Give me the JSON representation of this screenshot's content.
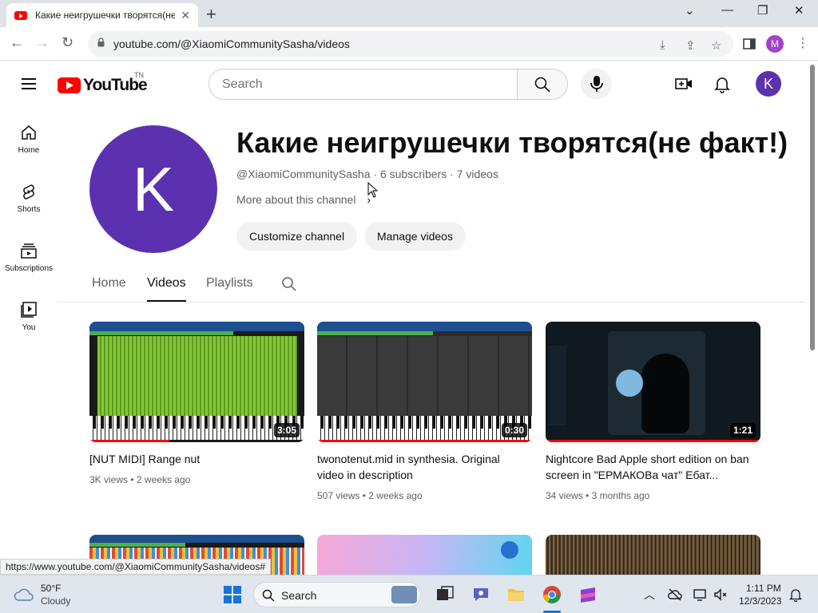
{
  "browser": {
    "tab_title": "Какие неигрушечки творятся(не факт!)",
    "url": "youtube.com/@XiaomiCommunitySasha/videos",
    "profile_initial": "M",
    "status_url": "https://www.youtube.com/@XiaomiCommunitySasha/videos#"
  },
  "header": {
    "logo_text": "YouTube",
    "logo_region": "TN",
    "search_placeholder": "Search",
    "avatar_initial": "K"
  },
  "sidebar": {
    "items": [
      {
        "label": "Home",
        "icon": "home-icon"
      },
      {
        "label": "Shorts",
        "icon": "shorts-icon"
      },
      {
        "label": "Subscriptions",
        "icon": "subscriptions-icon"
      },
      {
        "label": "You",
        "icon": "you-icon"
      }
    ]
  },
  "channel": {
    "avatar_initial": "K",
    "name": "Какие неигрушечки творятся(не факт!)",
    "handle": "@XiaomiCommunitySasha",
    "subscribers": "6 subscribers",
    "video_count": "7 videos",
    "more_about": "More about this channel",
    "customize_label": "Customize channel",
    "manage_label": "Manage videos"
  },
  "tabs": [
    {
      "label": "Home",
      "active": false
    },
    {
      "label": "Videos",
      "active": true
    },
    {
      "label": "Playlists",
      "active": false
    }
  ],
  "videos": [
    {
      "title": "[NUT MIDI] Range nut",
      "duration": "3:05",
      "views": "3K views",
      "age": "2 weeks ago"
    },
    {
      "title": "twonotenut.mid in synthesia. Original video in description",
      "duration": "0:30",
      "views": "507 views",
      "age": "2 weeks ago"
    },
    {
      "title": "Nightcore Bad Apple short edition on ban screen in \"ЕРМАКОВа чат\" Ебат...",
      "duration": "1:21",
      "views": "34 views",
      "age": "3 months ago"
    }
  ],
  "taskbar": {
    "temperature": "50°F",
    "condition": "Cloudy",
    "search_label": "Search",
    "time": "1:11 PM",
    "date": "12/3/2023"
  },
  "colors": {
    "youtube_red": "#ff0000",
    "avatar_purple": "#5b31b0",
    "profile_purple": "#a142c8"
  }
}
